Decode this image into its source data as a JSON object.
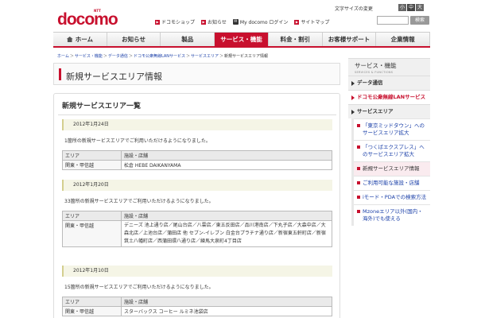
{
  "header": {
    "logo_ntt": "NTT",
    "logo": "docomo",
    "text_size_label": "文字サイズの変更",
    "size_buttons": [
      "小",
      "中",
      "大"
    ],
    "search_button": "検索",
    "top_links": [
      "ドコモショップ",
      "お知らせ",
      "My docomo ログイン",
      "サイトマップ"
    ]
  },
  "nav": {
    "items": [
      "ホーム",
      "お知らせ",
      "製品",
      "サービス・機能",
      "料金・割引",
      "お客様サポート",
      "企業情報"
    ],
    "active_index": 3
  },
  "breadcrumb": {
    "items": [
      "ホーム",
      "サービス・機能",
      "データ通信",
      "ドコモ公衆無線LANサービス",
      "サービスエリア"
    ],
    "current": "新規サービスエリア情報",
    "separator": "＞"
  },
  "page_title": "新規サービスエリア情報",
  "panel": {
    "title": "新規サービスエリア一覧",
    "sections": [
      {
        "date": "2012年1月24日",
        "message": "1箇所の新規サービスエリアでご利用いただけるようになりました。",
        "headers": [
          "エリア",
          "施設・店舗"
        ],
        "rows": [
          [
            "関東・甲信越",
            "松倉 HEBE DAIKANYAMA"
          ]
        ]
      },
      {
        "date": "2012年1月20日",
        "message": "33箇所の新規サービスエリアでご利用いただけるようになりました。",
        "headers": [
          "エリア",
          "施設・店舗"
        ],
        "rows": [
          [
            "関東・甲信越",
            "デニーズ 池上通り店／尾山台店／八雲店／東五反田店／品川港南店／下丸子店／大森中店／大森北店／上池台店／蒲田店 他 セブン-イレブン 白金台プラチナ通り店／新宿東五軒町店／新宿筑土八幡町店／西蒲田環八通り店／練馬大泉町4丁目店"
          ]
        ]
      },
      {
        "date": "2012年1月10日",
        "message": "15箇所の新規サービスエリアでご利用いただけるようになりました。",
        "headers": [
          "エリア",
          "施設・店舗"
        ],
        "rows": [
          [
            "関東・甲信越",
            "スターバックス コーヒー ルミネ池袋店"
          ]
        ]
      }
    ]
  },
  "sidebar": {
    "title": "サービス・機能",
    "subtitle": "SERVICES & FUNCTIONS",
    "categories": [
      {
        "label": "データ通信",
        "red": false
      },
      {
        "label": "ドコモ公衆無線LANサービス",
        "red": true
      },
      {
        "label": "サービスエリア",
        "red": false
      }
    ],
    "items": [
      {
        "label": "「東京ミッドタウン」へのサービスエリア拡大",
        "current": false
      },
      {
        "label": "「つくばエクスプレス」へのサービスエリア拡大",
        "current": false
      },
      {
        "label": "新規サービスエリア情報",
        "current": true
      },
      {
        "label": "ご利用可能な施設・店舗",
        "current": false
      },
      {
        "label": "iモード・PDAでの検索方法",
        "current": false
      },
      {
        "label": "Mzoneエリア以外(国内・海外)でも使える",
        "current": false
      }
    ]
  },
  "colors": {
    "brand": "#c8102e",
    "link": "#1a3fa8"
  }
}
